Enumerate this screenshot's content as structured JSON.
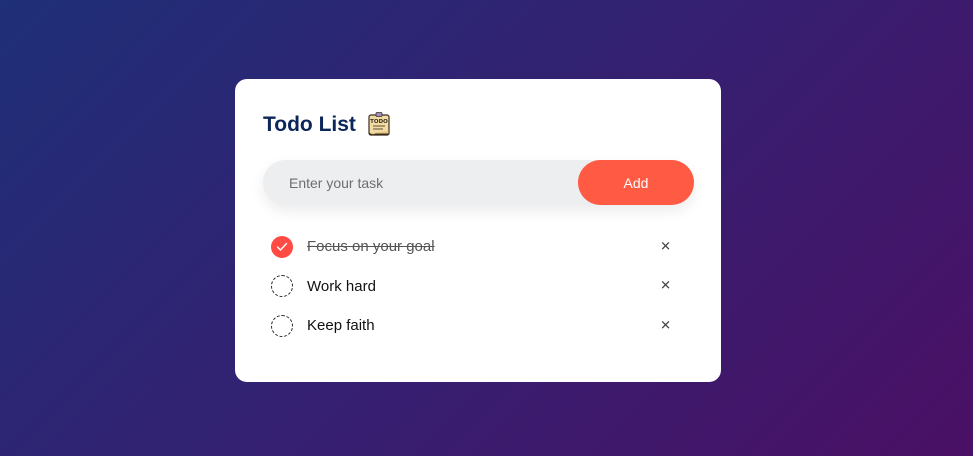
{
  "header": {
    "title": "Todo List",
    "icon": "todo-note-icon",
    "icon_text": "TODO"
  },
  "input": {
    "placeholder": "Enter your task",
    "value": ""
  },
  "add_button": {
    "label": "Add"
  },
  "tasks": [
    {
      "label": "Focus on your goal",
      "completed": true
    },
    {
      "label": "Work hard",
      "completed": false
    },
    {
      "label": "Keep faith",
      "completed": false
    }
  ],
  "delete_icon": "✕",
  "colors": {
    "accent": "#ff5a44",
    "check": "#ff4b43",
    "title": "#0b2659"
  }
}
